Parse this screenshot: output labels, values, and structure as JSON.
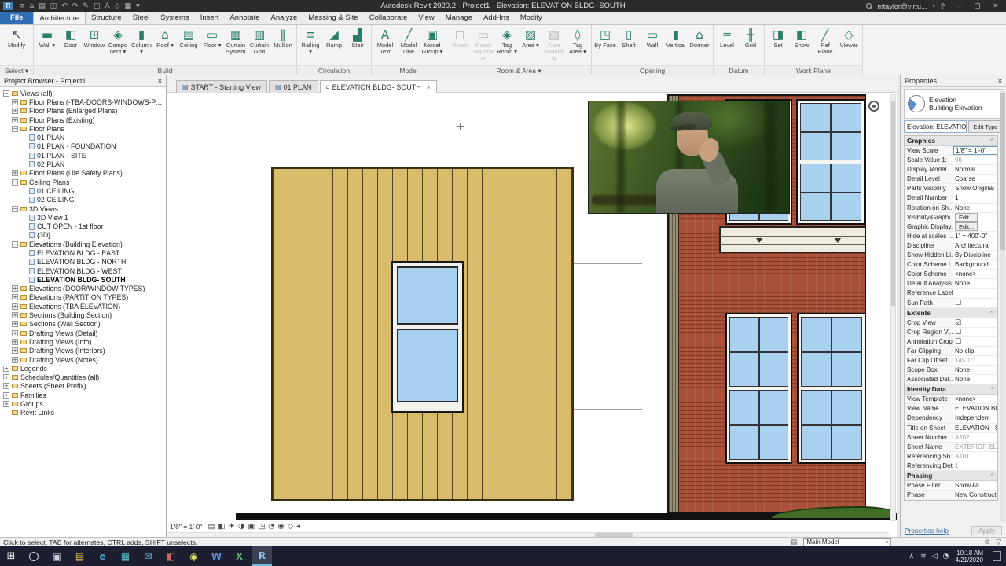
{
  "colors": {
    "accent_blue": "#2f6db5",
    "siding_tan": "#d9bb6c",
    "brick_red": "#a85138",
    "window_blue": "#a8d0ef",
    "taskbar_dark": "#1b1f30"
  },
  "titlebar": {
    "app_button": "R",
    "qat_icons": [
      [
        "app-menu-icon",
        "≡"
      ],
      [
        "home-icon",
        "⌂"
      ],
      [
        "open-icon",
        "▤"
      ],
      [
        "save-icon",
        "◫"
      ],
      [
        "undo-icon",
        "↶"
      ],
      [
        "redo-icon",
        "↷"
      ],
      [
        "print-icon",
        "✎"
      ],
      [
        "measure-icon",
        "◳"
      ],
      [
        "text-icon",
        "A"
      ],
      [
        "default-3d-view-icon",
        "◇"
      ],
      [
        "section-icon",
        "▦"
      ],
      [
        "qat-more-icon",
        "▾"
      ]
    ],
    "title": "Autodesk Revit 2020.2 - Project1 - Elevation: ELEVATION BLDG- SOUTH",
    "user": "mtaylor@virtu...",
    "user_menu_icon": "▾",
    "help_icon": "?",
    "window_controls": [
      [
        "minimize-button",
        "–"
      ],
      [
        "maximize-button",
        "▢"
      ],
      [
        "close-button",
        "×"
      ]
    ]
  },
  "ribbon": {
    "file_tab": "File",
    "tabs": [
      {
        "label": "Architecture",
        "active": true
      },
      {
        "label": "Structure"
      },
      {
        "label": "Steel"
      },
      {
        "label": "Systems"
      },
      {
        "label": "Insert"
      },
      {
        "label": "Annotate"
      },
      {
        "label": "Analyze"
      },
      {
        "label": "Massing & Site"
      },
      {
        "label": "Collaborate"
      },
      {
        "label": "View"
      },
      {
        "label": "Manage"
      },
      {
        "label": "Add-Ins"
      },
      {
        "label": "Modify"
      }
    ],
    "groups": [
      {
        "label": "Select",
        "menu": true,
        "tools": [
          {
            "label": "Modify",
            "glyph": "↖",
            "big": true,
            "color": "#44506b"
          }
        ]
      },
      {
        "label": "Build",
        "tools": [
          {
            "label": "Wall",
            "glyph": "▬",
            "menu": true
          },
          {
            "label": "Door",
            "glyph": "◧"
          },
          {
            "label": "Window",
            "glyph": "⊞"
          },
          {
            "label": "Component",
            "glyph": "◈",
            "menu": true
          },
          {
            "label": "Column",
            "glyph": "▮",
            "menu": true
          },
          {
            "label": "Roof",
            "glyph": "⌂",
            "menu": true
          },
          {
            "label": "Ceiling",
            "glyph": "▤"
          },
          {
            "label": "Floor",
            "glyph": "▭",
            "menu": true
          },
          {
            "label": "Curtain System",
            "glyph": "▦"
          },
          {
            "label": "Curtain Grid",
            "glyph": "▥"
          },
          {
            "label": "Mullion",
            "glyph": "∥"
          }
        ]
      },
      {
        "label": "Circulation",
        "tools": [
          {
            "label": "Railing",
            "glyph": "≡",
            "menu": true
          },
          {
            "label": "Ramp",
            "glyph": "◢"
          },
          {
            "label": "Stair",
            "glyph": "▟"
          }
        ]
      },
      {
        "label": "Model",
        "tools": [
          {
            "label": "Model Text",
            "glyph": "A"
          },
          {
            "label": "Model Line",
            "glyph": "╱"
          },
          {
            "label": "Model Group",
            "glyph": "▣",
            "menu": true
          }
        ]
      },
      {
        "label": "Room & Area",
        "menu": true,
        "tools": [
          {
            "label": "Room",
            "glyph": "◻",
            "disabled": true
          },
          {
            "label": "Room Separator",
            "glyph": "▭",
            "disabled": true
          },
          {
            "label": "Tag Room",
            "glyph": "◈",
            "menu": true
          },
          {
            "label": "Area",
            "glyph": "▨",
            "menu": true
          },
          {
            "label": "Area Boundary",
            "glyph": "▧",
            "disabled": true
          },
          {
            "label": "Tag Area",
            "glyph": "◊",
            "menu": true
          }
        ]
      },
      {
        "label": "Opening",
        "tools": [
          {
            "label": "By Face",
            "glyph": "◳"
          },
          {
            "label": "Shaft",
            "glyph": "▯"
          },
          {
            "label": "Wall",
            "glyph": "▭"
          },
          {
            "label": "Vertical",
            "glyph": "▮"
          },
          {
            "label": "Dormer",
            "glyph": "⌂"
          }
        ]
      },
      {
        "label": "Datum",
        "tools": [
          {
            "label": "Level",
            "glyph": "═"
          },
          {
            "label": "Grid",
            "glyph": "╫"
          }
        ]
      },
      {
        "label": "Work Plane",
        "tools": [
          {
            "label": "Set",
            "glyph": "◨"
          },
          {
            "label": "Show",
            "glyph": "◧"
          },
          {
            "label": "Ref Plane",
            "glyph": "╱"
          },
          {
            "label": "Viewer",
            "glyph": "◇"
          }
        ]
      }
    ]
  },
  "view_tabs": [
    {
      "icon": "▤",
      "label": "START - Starting View"
    },
    {
      "icon": "▤",
      "label": "01 PLAN"
    },
    {
      "icon": "⌂",
      "label": "ELEVATION BLDG- SOUTH",
      "active": true,
      "close": "×"
    }
  ],
  "project_browser": {
    "title": "Project Browser - Project1",
    "close_icon": "×",
    "items": [
      [
        "Views (all)",
        0,
        "-",
        false
      ],
      [
        "Floor Plans (-TBA-DOORS-WINDOWS-PARTITIONS)",
        1,
        "+",
        false
      ],
      [
        "Floor Plans (Enlarged Plans)",
        1,
        "+",
        false
      ],
      [
        "Floor Plans (Existing)",
        1,
        "+",
        false
      ],
      [
        "Floor Plans",
        1,
        "-",
        false
      ],
      [
        "01 PLAN",
        2,
        null,
        false
      ],
      [
        "01 PLAN - FOUNDATION",
        2,
        null,
        false
      ],
      [
        "01 PLAN - SITE",
        2,
        null,
        false
      ],
      [
        "02 PLAN",
        2,
        null,
        false
      ],
      [
        "Floor Plans (Life Safety Plans)",
        1,
        "+",
        false
      ],
      [
        "Ceiling Plans",
        1,
        "-",
        false
      ],
      [
        "01 CEILING",
        2,
        null,
        false
      ],
      [
        "02 CEILING",
        2,
        null,
        false
      ],
      [
        "3D Views",
        1,
        "-",
        false
      ],
      [
        "3D View 1",
        2,
        null,
        false
      ],
      [
        "CUT OPEN - 1st floor",
        2,
        null,
        false
      ],
      [
        "{3D}",
        2,
        null,
        false
      ],
      [
        "Elevations (Building Elevation)",
        1,
        "-",
        false
      ],
      [
        "ELEVATION BLDG - EAST",
        2,
        null,
        false
      ],
      [
        "ELEVATION BLDG - NORTH",
        2,
        null,
        false
      ],
      [
        "ELEVATION BLDG - WEST",
        2,
        null,
        false
      ],
      [
        "ELEVATION BLDG- SOUTH",
        2,
        null,
        true
      ],
      [
        "Elevations (DOOR/WINDOW TYPES)",
        1,
        "+",
        false
      ],
      [
        "Elevations (PARTITION TYPES)",
        1,
        "+",
        false
      ],
      [
        "Elevations (TBA ELEVATION)",
        1,
        "+",
        false
      ],
      [
        "Sections (Building Section)",
        1,
        "+",
        false
      ],
      [
        "Sections (Wall Section)",
        1,
        "+",
        false
      ],
      [
        "Drafting Views (Detail)",
        1,
        "+",
        false
      ],
      [
        "Drafting Views (Info)",
        1,
        "+",
        false
      ],
      [
        "Drafting Views (Interiors)",
        1,
        "+",
        false
      ],
      [
        "Drafting Views (Notes)",
        1,
        "+",
        false
      ],
      [
        "Legends",
        0,
        "+",
        false
      ],
      [
        "Schedules/Quantities (all)",
        0,
        "+",
        false
      ],
      [
        "Sheets (Sheet Prefix)",
        0,
        "+",
        false
      ],
      [
        "Families",
        0,
        "+",
        false
      ],
      [
        "Groups",
        0,
        "+",
        false
      ],
      [
        "Revit Links",
        0,
        null,
        false
      ]
    ]
  },
  "properties": {
    "title": "Properties",
    "close_icon": "×",
    "type_name": "Elevation",
    "type_desc": "Building Elevation",
    "selector": "Elevation: ELEVATION B",
    "selector_arrow": "▾",
    "edit_type": "Edit Type",
    "help": "Properties help",
    "apply": "Apply",
    "sections": [
      {
        "header": "Graphics",
        "rows": [
          [
            "View Scale",
            "1/8\" = 1'-0\"",
            "dropdown",
            false
          ],
          [
            "Scale Value    1:",
            "96",
            "",
            true
          ],
          [
            "Display Model",
            "Normal",
            "",
            false
          ],
          [
            "Detail Level",
            "Coarse",
            "",
            false
          ],
          [
            "Parts Visibility",
            "Show Original",
            "",
            false
          ],
          [
            "Detail Number",
            "1",
            "",
            false
          ],
          [
            "Rotation on Sh...",
            "None",
            "",
            false
          ],
          [
            "Visibility/Graphi...",
            "Edit...",
            "button",
            false
          ],
          [
            "Graphic Display...",
            "Edit...",
            "button",
            false
          ],
          [
            "Hide at scales ...",
            "1\" = 400'-0\"",
            "",
            false
          ],
          [
            "Discipline",
            "Architectural",
            "",
            false
          ],
          [
            "Show Hidden Li...",
            "By Discipline",
            "",
            false
          ],
          [
            "Color Scheme L...",
            "Background",
            "",
            false
          ],
          [
            "Color Scheme",
            "<none>",
            "",
            false
          ],
          [
            "Default Analysis...",
            "None",
            "",
            false
          ],
          [
            "Reference Label",
            "",
            "",
            false
          ],
          [
            "Sun Path",
            false,
            "check",
            false
          ]
        ]
      },
      {
        "header": "Extents",
        "rows": [
          [
            "Crop View",
            true,
            "check",
            false
          ],
          [
            "Crop Region Vi...",
            false,
            "check",
            false
          ],
          [
            "Annotation Crop",
            false,
            "check",
            false
          ],
          [
            "Far Clipping",
            "No clip",
            "",
            false
          ],
          [
            "Far Clip Offset",
            "145'  0\"",
            "",
            true
          ],
          [
            "Scope Box",
            "None",
            "",
            false
          ],
          [
            "Associated Dat...",
            "None",
            "",
            false
          ]
        ]
      },
      {
        "header": "Identity Data",
        "rows": [
          [
            "View Template",
            "<none>",
            "",
            false
          ],
          [
            "View Name",
            "ELEVATION BLD...",
            "",
            false
          ],
          [
            "Dependency",
            "Independent",
            "",
            false
          ],
          [
            "Title on Sheet",
            "ELEVATION - SO...",
            "",
            false
          ],
          [
            "Sheet Number",
            "A202",
            "",
            true
          ],
          [
            "Sheet Name",
            "EXTERIOR ELEVA...",
            "",
            true
          ],
          [
            "Referencing Sh...",
            "A101",
            "",
            true
          ],
          [
            "Referencing Det...",
            "1",
            "",
            true
          ]
        ]
      },
      {
        "header": "Phasing",
        "rows": [
          [
            "Phase Filter",
            "Show All",
            "",
            false
          ],
          [
            "Phase",
            "New Construction",
            "",
            false
          ]
        ]
      }
    ]
  },
  "view_control_bar": {
    "scale": "1/8\" = 1'-0\"",
    "icons": [
      [
        "detail-level-icon",
        "▤"
      ],
      [
        "visual-style-icon",
        "◧"
      ],
      [
        "sun-path-icon",
        "☀"
      ],
      [
        "shadows-icon",
        "◑"
      ],
      [
        "crop-view-icon",
        "▣"
      ],
      [
        "crop-region-icon",
        "◳"
      ],
      [
        "temporary-hide-isolate-icon",
        "◔"
      ],
      [
        "reveal-hidden-elements-icon",
        "◉"
      ],
      [
        "temporary-view-properties-icon",
        "◇"
      ]
    ],
    "pan_arrow": "◂"
  },
  "status_bar": {
    "hint": "Click to select, TAB for alternates, CTRL adds, SHIFT unselects.",
    "worksets_icon": "▤",
    "design_option_label": "Main Model",
    "dropdown_arrow": "▾",
    "filter_icon": "▽",
    "exclude_icon": "⊘"
  },
  "taskbar": {
    "start_icon": "⊞",
    "icons": [
      [
        "task-view-icon",
        "▣",
        "#cfd3dc"
      ],
      [
        "file-explorer-icon",
        "▤",
        "#e8c35a"
      ],
      [
        "edge-icon",
        "e",
        "#4ba6dd"
      ],
      [
        "store-icon",
        "▦",
        "#5fc3d0"
      ],
      [
        "mail-icon",
        "✉",
        "#7ab3e0"
      ],
      [
        "photos-icon",
        "◧",
        "#c96a5a"
      ],
      [
        "chrome-icon",
        "◉",
        "#d8e26a"
      ],
      [
        "word-icon",
        "W",
        "#5a8fd8"
      ],
      [
        "excel-icon",
        "X",
        "#5fae6e"
      ],
      [
        "revit-icon",
        "R",
        "#8fc3ef"
      ]
    ],
    "active_app": "revit-icon",
    "tray_chevron": "∧",
    "tray_icons": [
      [
        "network-icon",
        "≋"
      ],
      [
        "volume-icon",
        "◁"
      ],
      [
        "onedrive-icon",
        "◔"
      ]
    ],
    "time": "10:18 AM",
    "date": "4/21/2020"
  }
}
